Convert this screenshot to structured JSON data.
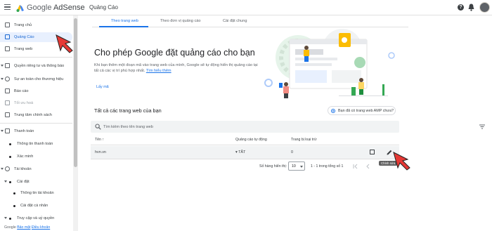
{
  "header": {
    "brand_google": "Google",
    "brand_product": "AdSense",
    "page_title": "Quảng Cáo",
    "help_icon": "help-icon",
    "notification_icon": "bell-icon"
  },
  "sidebar": {
    "items": [
      {
        "label": "Trang chủ",
        "icon": "home-icon"
      },
      {
        "label": "Quảng Cáo",
        "icon": "ads-icon"
      },
      {
        "label": "Trang web",
        "icon": "web-icon"
      },
      {
        "label": "Quyền riêng tư và thông báo",
        "icon": "privacy-icon"
      },
      {
        "label": "Sự an toàn cho thương hiệu",
        "icon": "brand-safety-icon"
      },
      {
        "label": "Báo cáo",
        "icon": "reports-icon"
      },
      {
        "label": "Tối ưu hoá",
        "icon": "optimize-icon"
      },
      {
        "label": "Trung tâm chính sách",
        "icon": "policy-icon"
      },
      {
        "label": "Thanh toán",
        "icon": "payments-icon"
      },
      {
        "label": "Thông tin thanh toán"
      },
      {
        "label": "Xác minh"
      },
      {
        "label": "Tài khoản",
        "icon": "settings-icon"
      },
      {
        "label": "Cài đặt"
      },
      {
        "label": "Thông tin tài khoản"
      },
      {
        "label": "Cài đặt cá nhân"
      },
      {
        "label": "Truy cập và uỷ quyền"
      }
    ],
    "footer": {
      "google": "Google",
      "privacy": "Bảo mật",
      "terms": "Điều khoản"
    }
  },
  "tabs": [
    {
      "label": "Theo trang web"
    },
    {
      "label": "Theo đơn vị quảng cáo"
    },
    {
      "label": "Cài đặt chung"
    }
  ],
  "hero": {
    "title": "Cho phép Google đặt quảng cáo cho bạn",
    "desc": "Khi bạn thêm một đoạn mã vào trang web của mình, Google sẽ tự động hiển thị quảng cáo tại tất cả các vị trí phù hợp nhất.",
    "learn_link": "Tìm hiểu thêm",
    "get_code": "Lấy mã"
  },
  "sites": {
    "title": "Tất cả các trang web của bạn",
    "amp_label": "Bạn đã có trang web AMP chưa?",
    "search_placeholder": "Tìm kiếm theo tên trang web",
    "columns": {
      "name": "Tên",
      "sort_arrow": "↑",
      "auto_ads": "Quảng cáo tự động",
      "excluded_pages": "Trang bị loại trừ"
    },
    "rows": [
      {
        "name": "hvn.vn",
        "auto_ads": "▾ TẮT",
        "excluded": "0"
      }
    ],
    "edit_tooltip": "Chỉnh sửa"
  },
  "pagination": {
    "rows_per_page_label": "Số hàng hiển thị:",
    "rows_per_page": "10",
    "range": "1 - 1 trong tổng số 1"
  },
  "colors": {
    "accent": "#1a73e8",
    "active_bg": "#e8f0fe",
    "cursor": "#e53935"
  }
}
